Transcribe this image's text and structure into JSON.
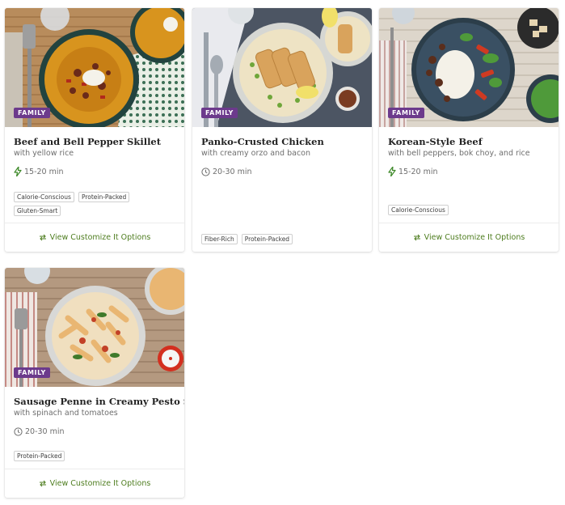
{
  "colors": {
    "accent_green": "#4e7d1f",
    "badge_purple": "#6c3a8c",
    "quick_icon_green": "#3f8a2a"
  },
  "recipes": [
    {
      "badge": "FAMILY",
      "title": "Beef and Bell Pepper Skillet",
      "subtitle": "with yellow rice",
      "time": "15-20 min",
      "time_icon": "lightning-bolt-icon",
      "tags": [
        "Calorie-Conscious",
        "Protein-Packed",
        "Gluten-Smart"
      ],
      "action": "View Customize It Options"
    },
    {
      "badge": "FAMILY",
      "title": "Panko-Crusted Chicken",
      "subtitle": "with creamy orzo and bacon",
      "time": "20-30 min",
      "time_icon": "clock-icon",
      "tags": [
        "Fiber-Rich",
        "Protein-Packed"
      ],
      "action": ""
    },
    {
      "badge": "FAMILY",
      "title": "Korean-Style Beef",
      "subtitle": "with bell peppers, bok choy, and rice",
      "time": "15-20 min",
      "time_icon": "lightning-bolt-icon",
      "tags": [
        "Calorie-Conscious"
      ],
      "action": "View Customize It Options"
    },
    {
      "badge": "FAMILY",
      "title": "Sausage Penne in Creamy Pesto Sauce",
      "subtitle": "with spinach and tomatoes",
      "time": "20-30 min",
      "time_icon": "clock-icon",
      "tags": [
        "Protein-Packed"
      ],
      "action": "View Customize It Options"
    }
  ]
}
